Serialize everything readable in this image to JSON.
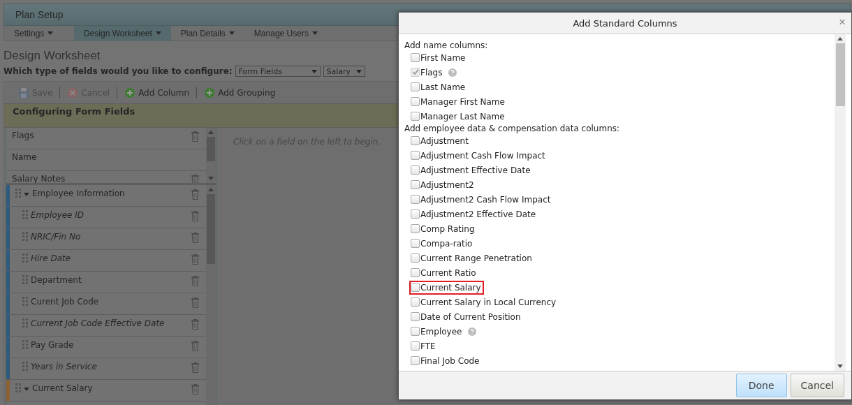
{
  "app": {
    "title": "Plan Setup"
  },
  "nav": [
    {
      "label": "Settings",
      "selected": false
    },
    {
      "label": "Design Worksheet",
      "selected": true
    },
    {
      "label": "Plan Details",
      "selected": false
    },
    {
      "label": "Manage Users",
      "selected": false
    }
  ],
  "page_title": "Design Worksheet",
  "config": {
    "label": "Which type of fields would you like to configure:",
    "field_type": "Form Fields",
    "plan": "Salary"
  },
  "toolbar": [
    {
      "label": "Save",
      "kind": "save",
      "disabled": true
    },
    {
      "label": "Cancel",
      "kind": "cancel",
      "disabled": true
    },
    {
      "label": "Add Column",
      "kind": "add",
      "disabled": false
    },
    {
      "label": "Add Grouping",
      "kind": "add",
      "disabled": false
    }
  ],
  "banner": "Configuring Form Fields",
  "top_fields": [
    {
      "label": "Flags",
      "deletable": true
    },
    {
      "label": "Name",
      "deletable": false
    },
    {
      "label": "Salary Notes",
      "deletable": true
    }
  ],
  "groups": [
    {
      "label": "Employee Information",
      "color": "#2f5a7c",
      "expanded": true,
      "children": [
        {
          "label": "Employee ID",
          "italic": true
        },
        {
          "label": "NRIC/Fin No",
          "italic": true
        },
        {
          "label": "Hire Date",
          "italic": true
        },
        {
          "label": "Department",
          "italic": false
        },
        {
          "label": "Curent Job Code",
          "italic": false
        },
        {
          "label": "Current Job Code Effective Date",
          "italic": true
        },
        {
          "label": "Pay Grade",
          "italic": false
        },
        {
          "label": "Years in Service",
          "italic": true
        }
      ]
    },
    {
      "label": "Current Salary",
      "color": "#8c6232",
      "expanded": true
    }
  ],
  "hint": "Click on a field on the left to begin.",
  "dialog": {
    "title": "Add Standard Columns",
    "close": "×",
    "sections": [
      {
        "heading": "Add name columns:",
        "items": [
          {
            "label": "First Name",
            "checked": false,
            "disabled": false,
            "help": false,
            "highlighted": false
          },
          {
            "label": "Flags",
            "checked": true,
            "disabled": true,
            "help": true,
            "highlighted": false
          },
          {
            "label": "Last Name",
            "checked": false,
            "disabled": false,
            "help": false,
            "highlighted": false
          },
          {
            "label": "Manager First Name",
            "checked": false,
            "disabled": false,
            "help": false,
            "highlighted": false
          },
          {
            "label": "Manager Last Name",
            "checked": false,
            "disabled": false,
            "help": false,
            "highlighted": false
          }
        ]
      },
      {
        "heading": "Add employee data & compensation data columns:",
        "items": [
          {
            "label": "Adjustment",
            "checked": false,
            "disabled": false,
            "help": false,
            "highlighted": false
          },
          {
            "label": "Adjustment Cash Flow Impact",
            "checked": false,
            "disabled": false,
            "help": false,
            "highlighted": false
          },
          {
            "label": "Adjustment Effective Date",
            "checked": false,
            "disabled": false,
            "help": false,
            "highlighted": false
          },
          {
            "label": "Adjustment2",
            "checked": false,
            "disabled": false,
            "help": false,
            "highlighted": false
          },
          {
            "label": "Adjustment2 Cash Flow Impact",
            "checked": false,
            "disabled": false,
            "help": false,
            "highlighted": false
          },
          {
            "label": "Adjustment2 Effective Date",
            "checked": false,
            "disabled": false,
            "help": false,
            "highlighted": false
          },
          {
            "label": "Comp Rating",
            "checked": false,
            "disabled": false,
            "help": false,
            "highlighted": false
          },
          {
            "label": "Compa-ratio",
            "checked": false,
            "disabled": false,
            "help": false,
            "highlighted": false
          },
          {
            "label": "Current Range Penetration",
            "checked": false,
            "disabled": false,
            "help": false,
            "highlighted": false
          },
          {
            "label": "Current Ratio",
            "checked": false,
            "disabled": false,
            "help": false,
            "highlighted": false
          },
          {
            "label": "Current Salary",
            "checked": false,
            "disabled": false,
            "help": false,
            "highlighted": true
          },
          {
            "label": "Current Salary in Local Currency",
            "checked": false,
            "disabled": false,
            "help": false,
            "highlighted": false
          },
          {
            "label": "Date of Current Position",
            "checked": false,
            "disabled": false,
            "help": false,
            "highlighted": false
          },
          {
            "label": "Employee",
            "checked": false,
            "disabled": false,
            "help": true,
            "highlighted": false
          },
          {
            "label": "FTE",
            "checked": false,
            "disabled": false,
            "help": false,
            "highlighted": false
          },
          {
            "label": "Final Job Code",
            "checked": false,
            "disabled": false,
            "help": false,
            "highlighted": false
          }
        ]
      }
    ],
    "buttons": [
      {
        "label": "Done",
        "kind": "primary"
      },
      {
        "label": "Cancel",
        "kind": "secondary"
      }
    ]
  }
}
